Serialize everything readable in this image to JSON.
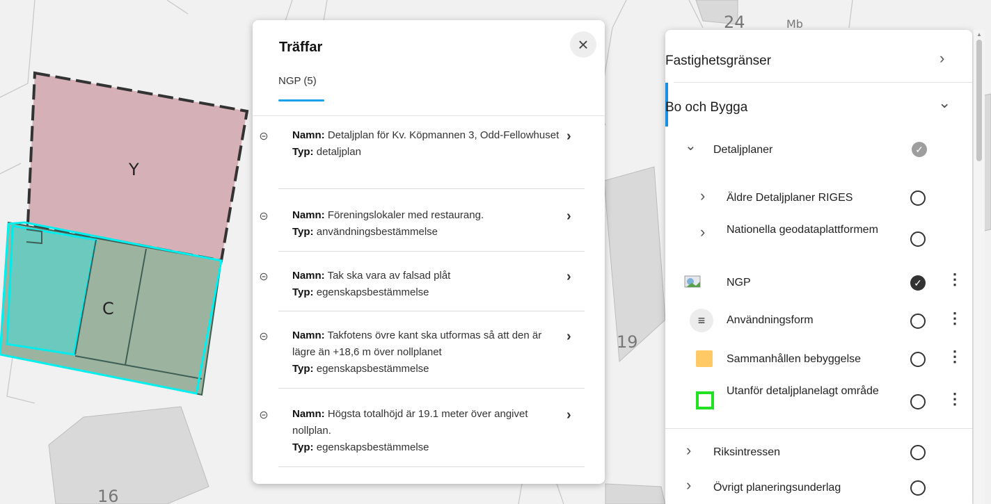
{
  "map": {
    "labels": {
      "y": "Y",
      "c": "C",
      "n24": "24",
      "mb": "Mb",
      "n19": "19",
      "n16": "16"
    }
  },
  "results": {
    "title": "Träffar",
    "close_icon": "×",
    "tab_label": "NGP (5)",
    "hits": [
      {
        "name_label": "Namn:",
        "name": "Detaljplan för Kv. Köpmannen 3, Odd-Fellowhuset",
        "type_label": "Typ:",
        "type": "detaljplan"
      },
      {
        "name_label": "Namn:",
        "name": "Föreningslokaler med restaurang.",
        "type_label": "Typ:",
        "type": "användningsbestämmelse"
      },
      {
        "name_label": "Namn:",
        "name": "Tak ska vara av falsad plåt",
        "type_label": "Typ:",
        "type": "egenskapsbestämmelse"
      },
      {
        "name_label": "Namn:",
        "name": "Takfotens övre kant ska utformas så att den är lägre än +18,6 m över nollplanet",
        "type_label": "Typ:",
        "type": "egenskapsbestämmelse"
      },
      {
        "name_label": "Namn:",
        "name": "Högsta totalhöjd är 19.1 meter över angivet nollplan.",
        "type_label": "Typ:",
        "type": "egenskapsbestämmelse"
      }
    ]
  },
  "layers": {
    "groups": [
      {
        "label": "Fastighetsgränser",
        "expanded": false
      },
      {
        "label": "Bo och Bygga",
        "expanded": true
      }
    ],
    "detaljplaner": {
      "label": "Detaljplaner",
      "checked": true
    },
    "sub_items": [
      {
        "label": "Äldre Detaljplaner RIGES",
        "checked": false
      },
      {
        "label": "Nationella geodataplattformem",
        "checked": false
      }
    ],
    "leaf_items": [
      {
        "label": "NGP",
        "icon": "map-image-icon",
        "checked": true
      },
      {
        "label": "Användningsform",
        "icon": "list-icon",
        "checked": false
      },
      {
        "label": "Sammanhållen bebyggelse",
        "icon": "orange-square-icon",
        "color": "#ffc966",
        "checked": false
      },
      {
        "label": "Utanför detaljplanelagt område",
        "icon": "green-outline-square-icon",
        "color": "#22e022",
        "checked": false
      }
    ],
    "bottom_items": [
      {
        "label": "Riksintressen",
        "checked": false
      },
      {
        "label": "Övrigt planeringsunderlag",
        "checked": false
      }
    ],
    "colors": {
      "accent": "#1a8fe0",
      "highlight": "#00f0f0",
      "plan_fill": "#d4b0b6"
    }
  }
}
